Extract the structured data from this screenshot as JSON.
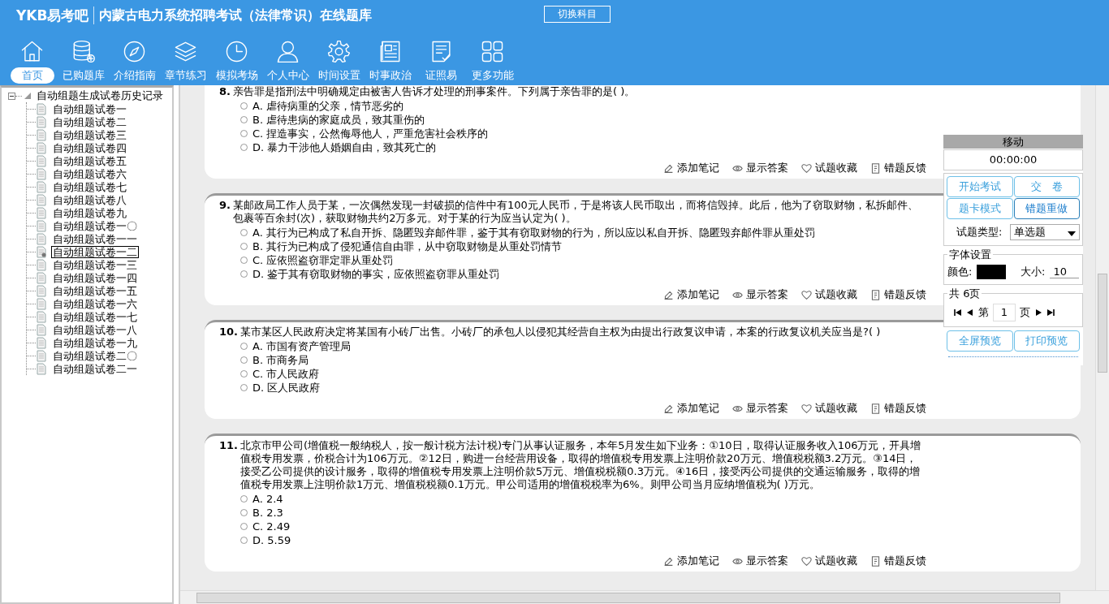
{
  "header": {
    "logo": "YKB易考吧",
    "title": "内蒙古电力系统招聘考试（法律常识）在线题库",
    "switch_button": "切换科目"
  },
  "nav": [
    {
      "label": "首页",
      "kind": "home",
      "selected": true
    },
    {
      "label": "已购题库",
      "kind": "db",
      "selected": false
    },
    {
      "label": "介绍指南",
      "kind": "compass",
      "selected": false
    },
    {
      "label": "章节练习",
      "kind": "layers",
      "selected": false
    },
    {
      "label": "模拟考场",
      "kind": "clock",
      "selected": false
    },
    {
      "label": "个人中心",
      "kind": "user",
      "selected": false
    },
    {
      "label": "时间设置",
      "kind": "gear",
      "selected": false
    },
    {
      "label": "时事政治",
      "kind": "news",
      "selected": false
    },
    {
      "label": "证照易",
      "kind": "list",
      "selected": false
    },
    {
      "label": "更多功能",
      "kind": "grid",
      "selected": false
    }
  ],
  "tree": {
    "label": "自动组题生成试卷历史记录",
    "expanded": true,
    "children": [
      {
        "label": "自动组题试卷一",
        "selected": false
      },
      {
        "label": "自动组题试卷二",
        "selected": false
      },
      {
        "label": "自动组题试卷三",
        "selected": false
      },
      {
        "label": "自动组题试卷四",
        "selected": false
      },
      {
        "label": "自动组题试卷五",
        "selected": false
      },
      {
        "label": "自动组题试卷六",
        "selected": false
      },
      {
        "label": "自动组题试卷七",
        "selected": false
      },
      {
        "label": "自动组题试卷八",
        "selected": false
      },
      {
        "label": "自动组题试卷九",
        "selected": false
      },
      {
        "label": "自动组题试卷一〇",
        "selected": false
      },
      {
        "label": "自动组题试卷一一",
        "selected": false
      },
      {
        "label": "自动组题试卷一二",
        "selected": true
      },
      {
        "label": "自动组题试卷一三",
        "selected": false
      },
      {
        "label": "自动组题试卷一四",
        "selected": false
      },
      {
        "label": "自动组题试卷一五",
        "selected": false
      },
      {
        "label": "自动组题试卷一六",
        "selected": false
      },
      {
        "label": "自动组题试卷一七",
        "selected": false
      },
      {
        "label": "自动组题试卷一八",
        "selected": false
      },
      {
        "label": "自动组题试卷一九",
        "selected": false
      },
      {
        "label": "自动组题试卷二〇",
        "selected": false
      },
      {
        "label": "自动组题试卷二一",
        "selected": false
      }
    ]
  },
  "questions": [
    {
      "number": "8.",
      "text": "亲告罪是指刑法中明确规定由被害人告诉才处理的刑事案件。下列属于亲告罪的是( )。",
      "options": [
        {
          "text": "A. 虐待病重的父亲，情节恶劣的",
          "selected": false
        },
        {
          "text": "B. 虐待患病的家庭成员，致其重伤的",
          "selected": false
        },
        {
          "text": "C. 捏造事实，公然侮辱他人，严重危害社会秩序的",
          "selected": false
        },
        {
          "text": "D. 暴力干涉他人婚姻自由，致其死亡的",
          "selected": false
        }
      ],
      "actions": [
        {
          "label": "添加笔记",
          "kind": "pencil"
        },
        {
          "label": "显示答案",
          "kind": "eye"
        },
        {
          "label": "试题收藏",
          "kind": "heart"
        },
        {
          "label": "错题反馈",
          "kind": "doc"
        }
      ]
    },
    {
      "number": "9.",
      "text": "某邮政局工作人员于某，一次偶然发现一封破损的信件中有100元人民币，于是将该人民币取出，而将信毁掉。此后，他为了窃取财物，私拆邮件、包裹等百余封(次)，获取财物共约2万多元。对于某的行为应当认定为( )。",
      "options": [
        {
          "text": "A. 其行为已构成了私自开拆、隐匿毁弃邮件罪，鉴于其有窃取财物的行为，所以应以私自开拆、隐匿毁弃邮件罪从重处罚",
          "selected": false
        },
        {
          "text": "B. 其行为已构成了侵犯通信自由罪，从中窃取财物是从重处罚情节",
          "selected": false
        },
        {
          "text": "C. 应依照盗窃罪定罪从重处罚",
          "selected": false
        },
        {
          "text": "D. 鉴于其有窃取财物的事实，应依照盗窃罪从重处罚",
          "selected": false
        }
      ],
      "actions": [
        {
          "label": "添加笔记",
          "kind": "pencil"
        },
        {
          "label": "显示答案",
          "kind": "eye"
        },
        {
          "label": "试题收藏",
          "kind": "heart"
        },
        {
          "label": "错题反馈",
          "kind": "doc"
        }
      ]
    },
    {
      "number": "10.",
      "text": "某市某区人民政府决定将某国有小砖厂出售。小砖厂的承包人以侵犯其经营自主权为由提出行政复议申请，本案的行政复议机关应当是?( )",
      "options": [
        {
          "text": "A. 市国有资产管理局",
          "selected": false
        },
        {
          "text": "B. 市商务局",
          "selected": false
        },
        {
          "text": "C. 市人民政府",
          "selected": false
        },
        {
          "text": "D. 区人民政府",
          "selected": false
        }
      ],
      "actions": [
        {
          "label": "添加笔记",
          "kind": "pencil"
        },
        {
          "label": "显示答案",
          "kind": "eye"
        },
        {
          "label": "试题收藏",
          "kind": "heart"
        },
        {
          "label": "错题反馈",
          "kind": "doc"
        }
      ]
    },
    {
      "number": "11.",
      "text": "北京市甲公司(增值税一般纳税人，按一般计税方法计税)专门从事认证服务，本年5月发生如下业务：①10日，取得认证服务收入106万元，开具增值税专用发票，价税合计为106万元。②12日，购进一台经营用设备，取得的增值税专用发票上注明价款20万元、增值税税额3.2万元。③14日，接受乙公司提供的设计服务，取得的增值税专用发票上注明价款5万元、增值税税额0.3万元。④16日，接受丙公司提供的交通运输服务，取得的增值税专用发票上注明价款1万元、增值税税额0.1万元。甲公司适用的增值税税率为6%。则甲公司当月应纳增值税为( )万元。",
      "options": [
        {
          "text": "A. 2.4",
          "selected": false
        },
        {
          "text": "B. 2.3",
          "selected": false
        },
        {
          "text": "C. 2.49",
          "selected": false
        },
        {
          "text": "D. 5.59",
          "selected": false
        }
      ],
      "actions": [
        {
          "label": "添加笔记",
          "kind": "pencil"
        },
        {
          "label": "显示答案",
          "kind": "eye"
        },
        {
          "label": "试题收藏",
          "kind": "heart"
        },
        {
          "label": "错题反馈",
          "kind": "doc"
        }
      ]
    }
  ],
  "panel": {
    "title": "移动",
    "timer": "00:00:00",
    "buttons": [
      {
        "label": "开始考试",
        "selected": false
      },
      {
        "label": "交　卷",
        "selected": false
      },
      {
        "label": "题卡模式",
        "selected": false
      },
      {
        "label": "错题重做",
        "selected": true
      }
    ],
    "type_label": "试题类型:",
    "type_value": "单选题",
    "font_group": "字体设置",
    "color_label": "颜色:",
    "color": "#000000",
    "size_label": "大小:",
    "size_value": "10",
    "pages_group": "共 6页",
    "page_prefix": "第",
    "page_value": "1",
    "page_suffix": "页",
    "bottom_buttons": [
      "全屏预览",
      "打印预览"
    ]
  }
}
